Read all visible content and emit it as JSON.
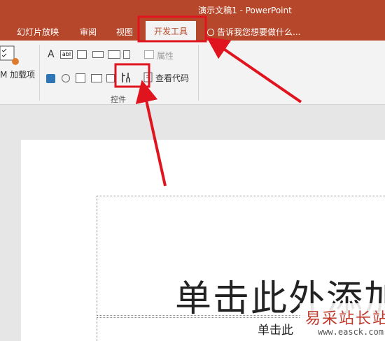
{
  "window": {
    "title": "演示文稿1 - PowerPoint"
  },
  "tabs": [
    {
      "label": "幻灯片放映"
    },
    {
      "label": "审阅"
    },
    {
      "label": "视图"
    },
    {
      "label": "开发工具",
      "active": true
    }
  ],
  "tell_me": "告诉我您想要做什么...",
  "ribbon": {
    "addins_label": "M 加载项",
    "controls": {
      "text_label_icon": "A",
      "textbox_icon": "abl",
      "properties_label": "属性",
      "view_code_label": "查看代码",
      "group_label": "控件"
    }
  },
  "slide": {
    "title_text": "单击此外添加",
    "subtitle_text": "单击此"
  },
  "watermark": {
    "name": "易采站长站",
    "url": "www.easck.com"
  },
  "colors": {
    "accent": "#b7472a",
    "annotation": "#e0141e"
  }
}
